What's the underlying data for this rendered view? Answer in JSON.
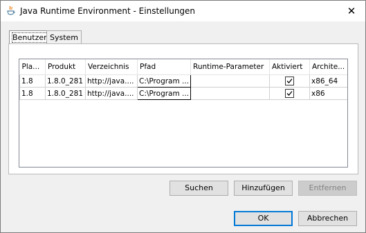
{
  "window": {
    "title": "Java Runtime Environment - Einstellungen",
    "close": "✕"
  },
  "tabs": [
    {
      "label": "Benutzer",
      "active": true
    },
    {
      "label": "System",
      "active": false
    }
  ],
  "table": {
    "columns": [
      "Pla...",
      "Produkt",
      "Verzeichnis",
      "Pfad",
      "Runtime-Parameter",
      "Aktiviert",
      "Archite..."
    ],
    "rows": [
      {
        "platform": "1.8",
        "product": "1.8.0_281",
        "location": "http://java....",
        "path": "C:\\Program ...",
        "params": "",
        "enabled": true,
        "arch": "x86_64"
      },
      {
        "platform": "1.8",
        "product": "1.8.0_281",
        "location": "http://java....",
        "path": "C:\\Program ...",
        "params": "",
        "enabled": true,
        "arch": "x86"
      }
    ]
  },
  "buttons": {
    "find": "Suchen",
    "add": "Hinzufügen",
    "remove": "Entfernen",
    "ok": "OK",
    "cancel": "Abbrechen"
  }
}
